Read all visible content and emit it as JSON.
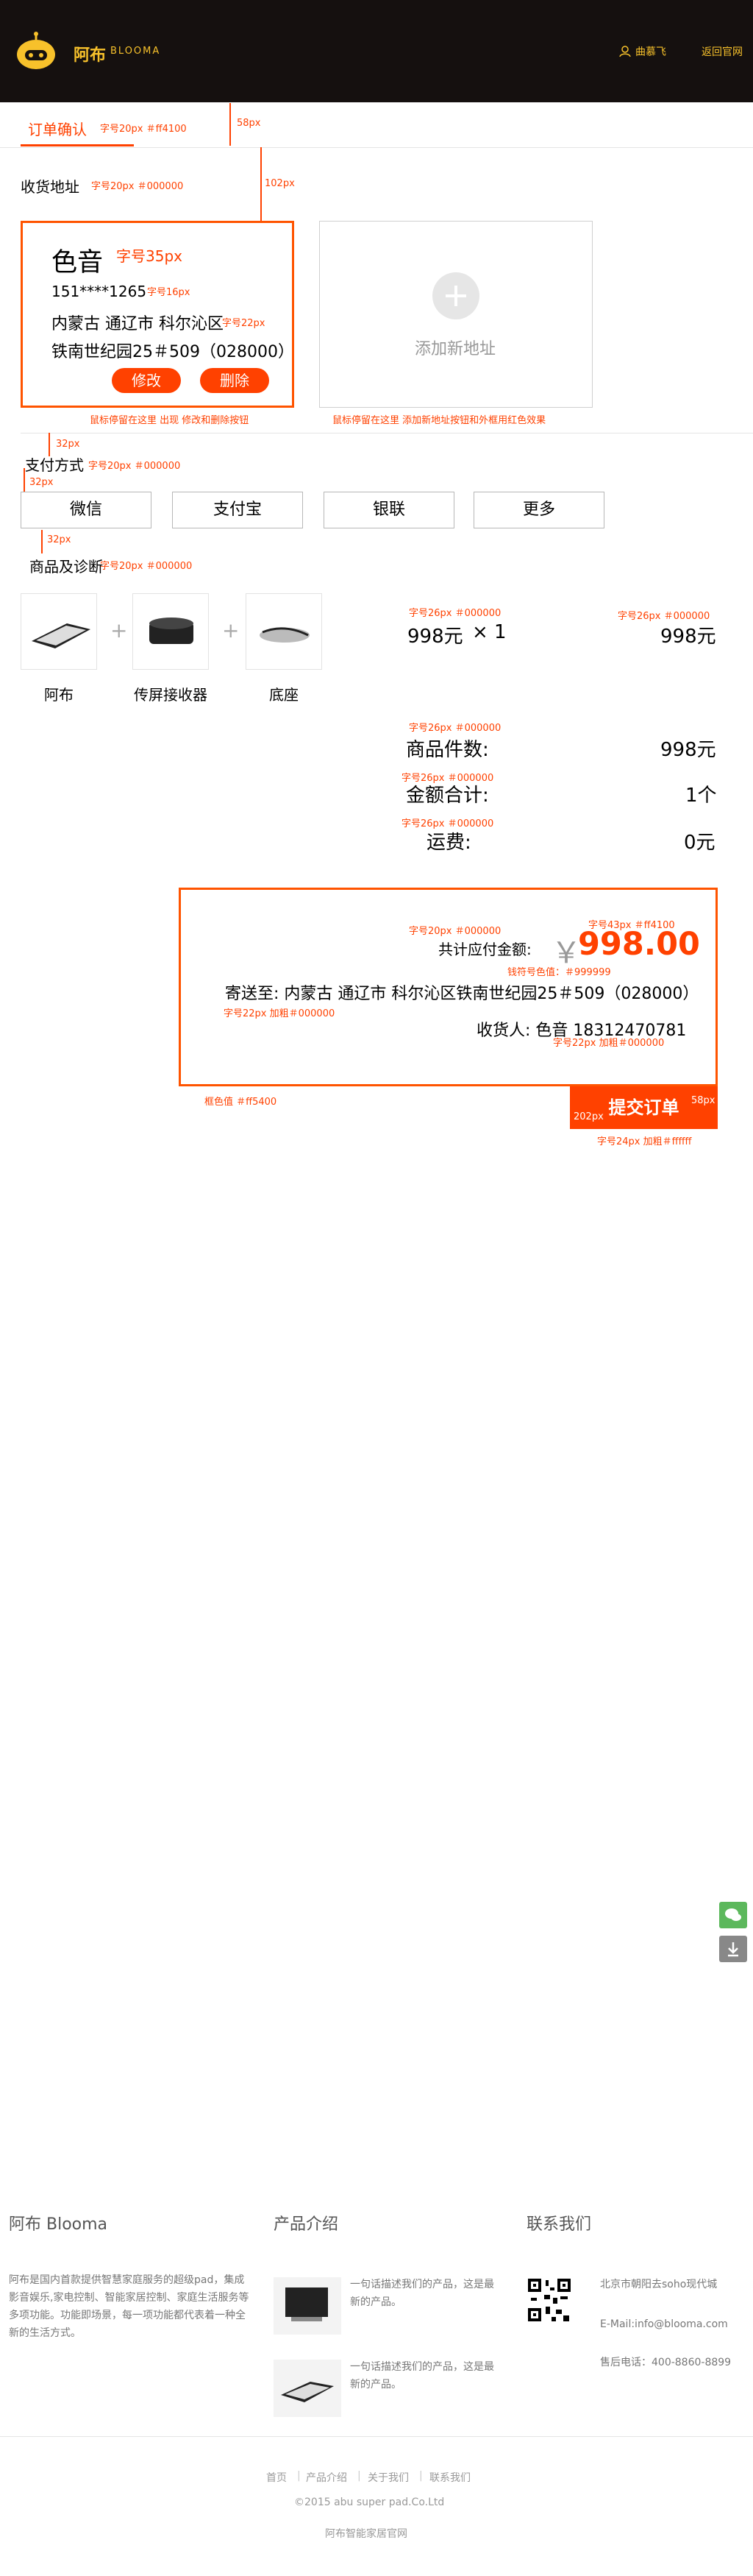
{
  "header": {
    "brand_cn": "阿布",
    "brand_en": "BLOOMA",
    "username": "曲慕飞",
    "home_link": "返回官网"
  },
  "tabs": {
    "active_label": "订单确认",
    "active_note": "字号20px ＃ff4100",
    "gap_note_58": "58px",
    "gap_note_102": "102px"
  },
  "address": {
    "section_title": "收货地址",
    "section_note": "字号20px ＃000000",
    "card": {
      "name": "色音",
      "name_note": "字号35px",
      "phone": "151****1265",
      "phone_note": "字号16px",
      "line1": "内蒙古 通辽市 科尔沁区",
      "line1_note": "字号22px",
      "line2": "铁南世纪园25＃509（028000）",
      "edit_label": "修改",
      "delete_label": "删除"
    },
    "card_hover_note": "鼠标停留在这里 出现 修改和删除按钮",
    "add_label": "添加新地址",
    "add_hover_note": "鼠标停留在这里 添加新地址按钮和外框用红色效果"
  },
  "payment": {
    "gap_note_32a": "32px",
    "gap_note_32b": "32px",
    "section_title": "支付方式",
    "section_note": "字号20px ＃000000",
    "options": [
      "微信",
      "支付宝",
      "银联",
      "更多"
    ]
  },
  "products": {
    "gap_note_32": "32px",
    "section_title": "商品及诊断",
    "section_note": "字号20px ＃000000",
    "items": [
      "阿布",
      "传屏接收器",
      "底座"
    ],
    "price_note": "字号26px ＃000000",
    "unit_price": "998元",
    "quantity": "× 1",
    "subtotal_note": "字号26px ＃000000",
    "subtotal": "998元"
  },
  "totals": {
    "count_note": "字号26px ＃000000",
    "count_label": "商品件数:",
    "count_value": "998元",
    "sum_note": "字号26px ＃000000",
    "sum_label": "金额合计:",
    "sum_value": "1个",
    "ship_note": "字号26px ＃000000",
    "ship_label": "运费:",
    "ship_value": "0元"
  },
  "summary": {
    "total_note": "字号20px ＃000000",
    "total_label": "共计应付金额:",
    "amount_note": "字号43px ＃ff4100",
    "currency": "￥",
    "amount": "998.00",
    "currency_note": "钱符号色值：＃999999",
    "ship_to": "寄送至:  内蒙古 通辽市 科尔沁区铁南世纪园25＃509（028000）",
    "ship_to_note": "字号22px 加粗＃000000",
    "receiver": "收货人:  色音 18312470781",
    "receiver_note": "字号22px 加粗＃000000",
    "border_note": "框色值 ＃ff5400",
    "submit_label": "提交订单",
    "submit_width_note": "202px",
    "submit_height_note": "58px",
    "submit_note": "字号24px 加粗＃ffffff"
  },
  "footer": {
    "col1_title": "阿布 Blooma",
    "col1_text": [
      "阿布是国内首款提供智慧家庭服务的超级pad，集成",
      "影音娱乐,家电控制、智能家居控制、家庭生活服务等",
      "多项功能。功能即场景，每一项功能都代表着一种全",
      "新的生活方式。"
    ],
    "col2_title": "产品介绍",
    "col2_items": [
      [
        "一句话描述我们的产品，这是最",
        "新的产品。"
      ],
      [
        "一句话描述我们的产品，这是最",
        "新的产品。"
      ]
    ],
    "col3_title": "联系我们",
    "address": "北京市朝阳去soho现代城",
    "email": "E-Mail:info@blooma.com",
    "phone": "售后电话：400-8860-8899",
    "links": [
      "首页",
      "产品介绍",
      "关于我们",
      "联系我们"
    ],
    "copyright": "©2015 abu super pad.Co.Ltd",
    "site_name": "阿布智能家居官网"
  },
  "colors": {
    "accent": "#ff4100",
    "border": "#ff5400",
    "header_bg": "#15100f",
    "brand": "#f7c12b"
  }
}
